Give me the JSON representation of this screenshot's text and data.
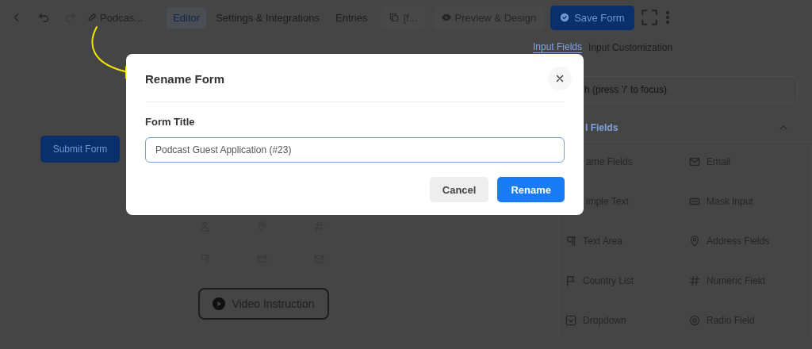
{
  "toolbar": {
    "form_name": "Podcas...",
    "tabs": [
      {
        "label": "Editor",
        "selected": true
      },
      {
        "label": "Settings & Integrations",
        "selected": false
      },
      {
        "label": "Entries",
        "selected": false
      }
    ],
    "shortcode": "[f...",
    "preview_button": "Preview & Design",
    "save_button": "Save Form"
  },
  "canvas": {
    "submit_button": "Submit Form",
    "shortcut_icons": [
      {
        "kind": "user"
      },
      {
        "kind": "pin"
      },
      {
        "kind": "hash"
      },
      {
        "kind": "paragraph"
      },
      {
        "kind": "card"
      },
      {
        "kind": "email"
      }
    ],
    "video_button": "Video Instruction"
  },
  "panel": {
    "tabs": [
      {
        "label": "Input Fields",
        "selected": true
      },
      {
        "label": "Input Customization",
        "selected": false
      }
    ],
    "search": {
      "placeholder": "h (press '/' to focus)"
    },
    "section": {
      "title": "l Fields",
      "expanded": true
    },
    "fields": [
      {
        "label": "ame Fields",
        "kind": "covered"
      },
      {
        "label": "Email",
        "kind": "email"
      },
      {
        "label": "imple Text",
        "kind": "covered"
      },
      {
        "label": "Mask Input",
        "kind": "mask"
      },
      {
        "label": "Text Area",
        "kind": "paragraph"
      },
      {
        "label": "Address Fields",
        "kind": "pin"
      },
      {
        "label": "Country List",
        "kind": "flag"
      },
      {
        "label": "Numeric Field",
        "kind": "hash"
      },
      {
        "label": "Dropdown",
        "kind": "dropdown"
      },
      {
        "label": "Radio Field",
        "kind": "radio"
      }
    ]
  },
  "dialog": {
    "title": "Rename Form",
    "field_label": "Form Title",
    "value": "Podcast Guest Application (#23)",
    "buttons": [
      {
        "label": "Cancel",
        "kind": "secondary"
      },
      {
        "label": "Rename",
        "kind": "primary"
      }
    ]
  }
}
